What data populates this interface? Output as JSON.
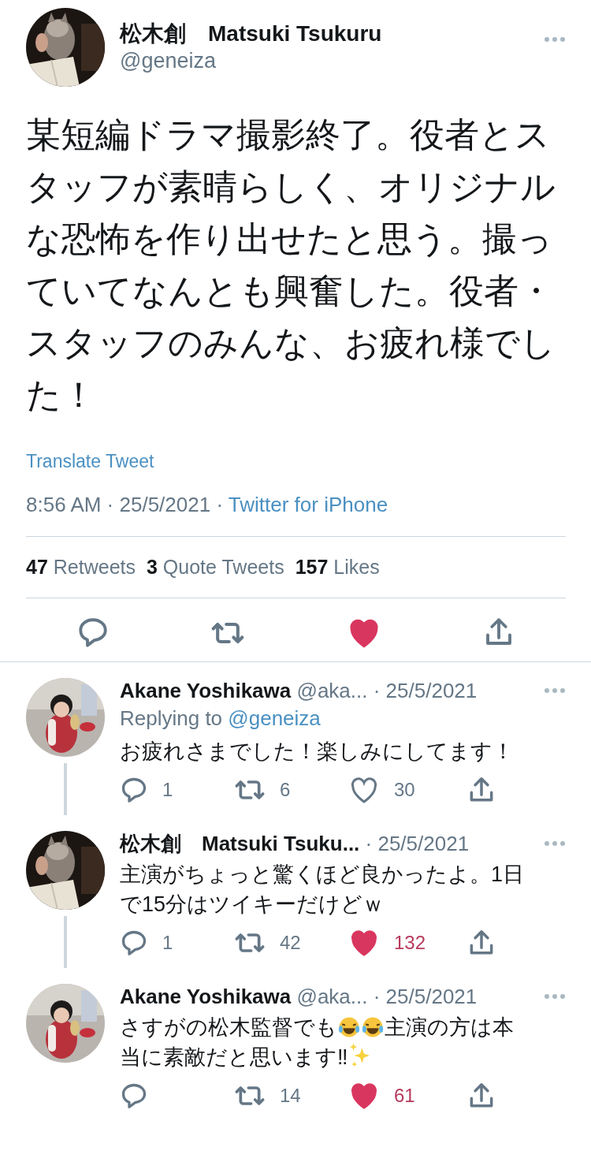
{
  "tweet": {
    "name": "松木創　Matsuki Tsukuru",
    "handle": "@geneiza",
    "body": "某短編ドラマ撮影終了。役者とスタッフが素晴らしく、オリジナルな恐怖を作り出せたと思う。撮っていてなんとも興奮した。役者・スタッフのみんな、お疲れ様でした！",
    "translate": "Translate Tweet",
    "time": "8:56 AM · 25/5/2021 · ",
    "source": "Twitter for iPhone",
    "stats": [
      {
        "count": "47",
        "label": "Retweets"
      },
      {
        "count": "3",
        "label": "Quote Tweets"
      },
      {
        "count": "157",
        "label": "Likes"
      }
    ],
    "liked": true
  },
  "replies": [
    {
      "name": "Akane Yoshikawa",
      "handle": "@aka...",
      "date": " · 25/5/2021",
      "replying_prefix": "Replying to ",
      "replying_to": "@geneiza",
      "body": [
        {
          "kind": "text",
          "text": "お疲れさまでした！楽しみにしてます！"
        }
      ],
      "replies": "1",
      "retweets": "6",
      "likes": "30",
      "liked": false,
      "thread_below": true
    },
    {
      "name": "松木創　Matsuki Tsuku...",
      "date": " · 25/5/2021",
      "body": [
        {
          "kind": "text",
          "text": "主演がちょっと驚くほど良かったよ。1日で15分はツイキーだけどｗ"
        }
      ],
      "replies": "1",
      "retweets": "42",
      "likes": "132",
      "liked": true,
      "thread_below": true
    },
    {
      "name": "Akane Yoshikawa",
      "handle": "@aka...",
      "date": " · 25/5/2021",
      "body": [
        {
          "kind": "text",
          "text": "さすがの松木監督でも"
        },
        {
          "kind": "laugh"
        },
        {
          "kind": "laugh"
        },
        {
          "kind": "text",
          "text": "主演の方は本当に素敵だと思います‼"
        },
        {
          "kind": "sparkles"
        }
      ],
      "retweets": "14",
      "likes": "61",
      "liked": true,
      "thread_below": false
    }
  ]
}
